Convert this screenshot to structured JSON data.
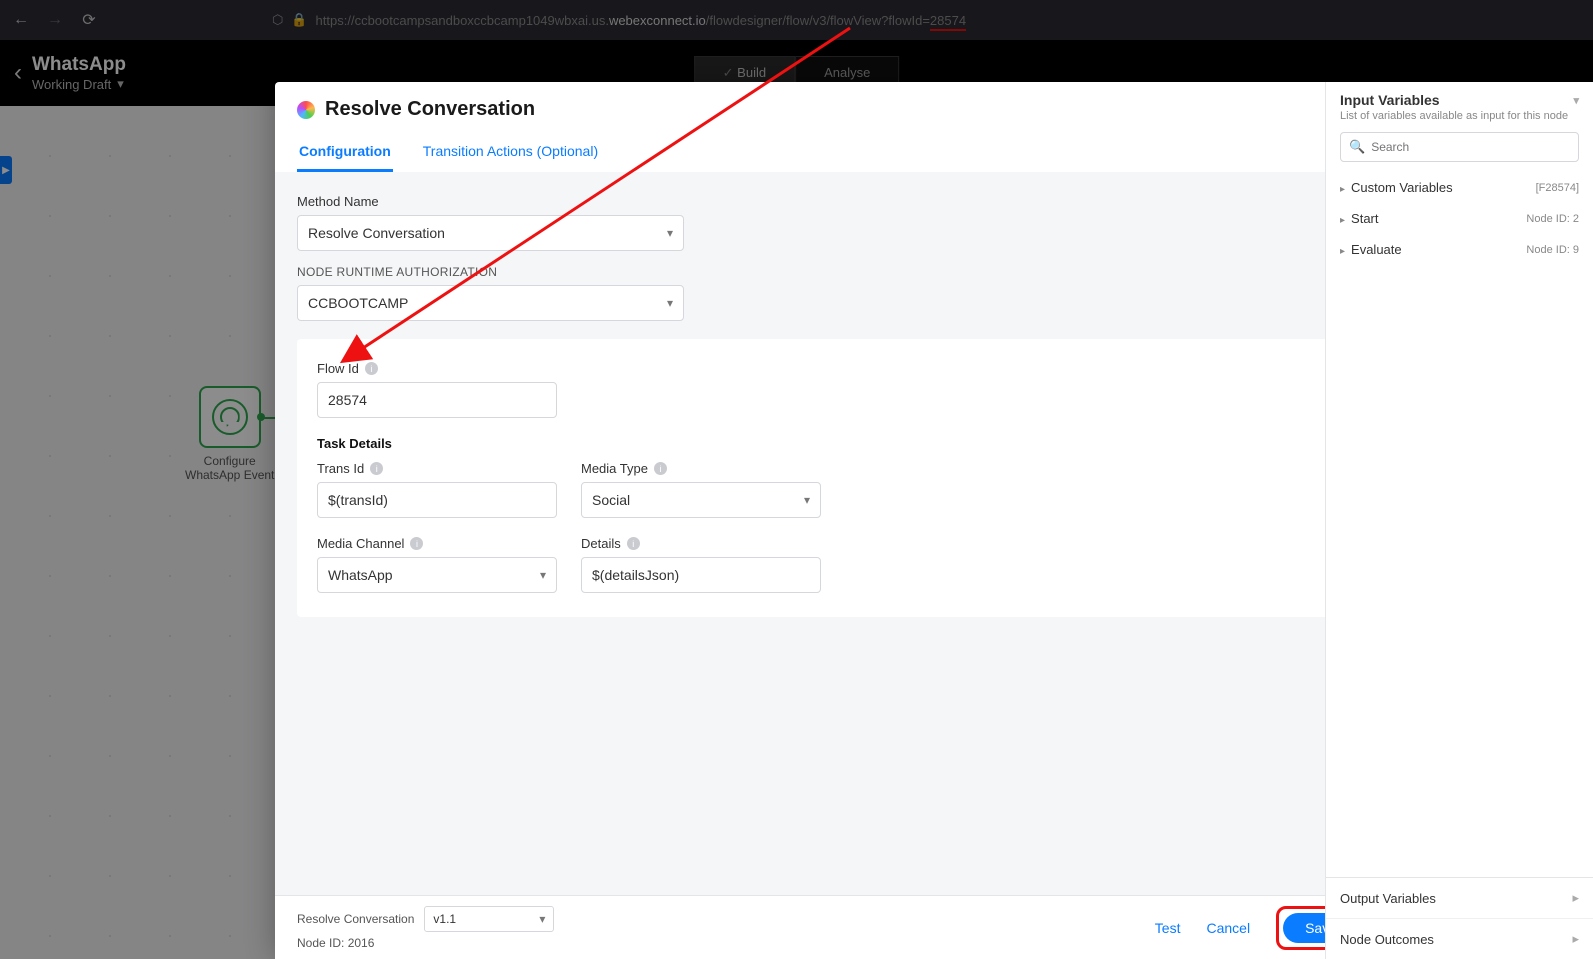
{
  "browser": {
    "url_pre": "https://ccbootcampsandboxccbcamp1049wbxai.us.",
    "url_host": "webexconnect.io",
    "url_path": "/flowdesigner/flow/v3/flowView?flowId=",
    "url_flowid": "28574"
  },
  "header": {
    "title": "WhatsApp",
    "subtitle": "Working Draft",
    "build": "Build",
    "analyse": "Analyse"
  },
  "canvas": {
    "node_label_1": "Configure",
    "node_label_2": "WhatsApp Event"
  },
  "modal": {
    "title": "Resolve Conversation",
    "tabs": {
      "config": "Configuration",
      "trans": "Transition Actions (Optional)"
    },
    "method_label": "Method Name",
    "method_value": "Resolve Conversation",
    "auth_label": "NODE RUNTIME AUTHORIZATION",
    "auth_value": "CCBOOTCAMP",
    "flowid_label": "Flow Id",
    "flowid_value": "28574",
    "task_header": "Task Details",
    "transid_label": "Trans Id",
    "transid_value": "$(transId)",
    "mediatype_label": "Media Type",
    "mediatype_value": "Social",
    "mediach_label": "Media Channel",
    "mediach_value": "WhatsApp",
    "details_label": "Details",
    "details_value": "$(detailsJson)",
    "footer": {
      "name": "Resolve Conversation",
      "version": "v1.1",
      "nodeid_label": "Node ID: 2016",
      "test": "Test",
      "cancel": "Cancel",
      "save": "Save"
    }
  },
  "rpanel": {
    "title": "Input Variables",
    "subtitle": "List of variables available as input for this node",
    "search_placeholder": "Search",
    "groups": [
      {
        "name": "Custom Variables",
        "meta": "[F28574]"
      },
      {
        "name": "Start",
        "meta": "Node ID: 2"
      },
      {
        "name": "Evaluate",
        "meta": "Node ID: 9"
      }
    ],
    "out": "Output Variables",
    "outcomes": "Node Outcomes"
  }
}
